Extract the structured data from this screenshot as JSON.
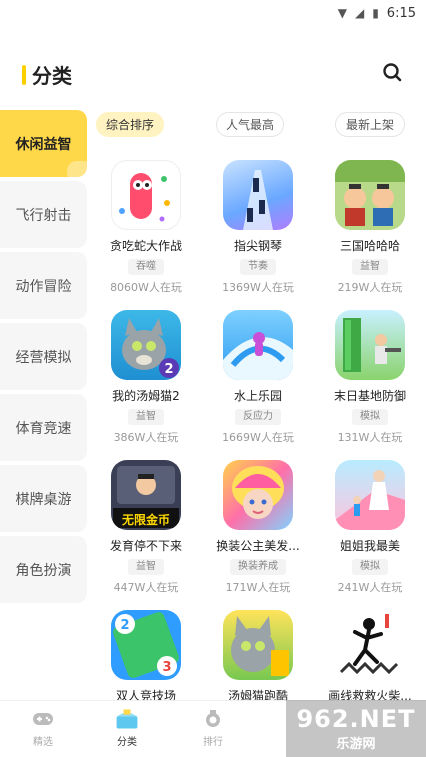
{
  "status_bar": {
    "time": "6:15"
  },
  "header": {
    "title": "分类"
  },
  "sidebar": {
    "items": [
      {
        "label": "休闲益智",
        "active": true
      },
      {
        "label": "飞行射击",
        "active": false
      },
      {
        "label": "动作冒险",
        "active": false
      },
      {
        "label": "经营模拟",
        "active": false
      },
      {
        "label": "体育竞速",
        "active": false
      },
      {
        "label": "棋牌桌游",
        "active": false
      },
      {
        "label": "角色扮演",
        "active": false
      }
    ]
  },
  "sort_tabs": [
    {
      "label": "综合排序",
      "active": true
    },
    {
      "label": "人气最高",
      "active": false
    },
    {
      "label": "最新上架",
      "active": false
    }
  ],
  "games": [
    {
      "name": "贪吃蛇大作战",
      "tag": "吞噬",
      "players": "8060W人在玩",
      "color": "#ff4d6d"
    },
    {
      "name": "指尖钢琴",
      "tag": "节奏",
      "players": "1369W人在玩",
      "color": "#5aa0ff"
    },
    {
      "name": "三国哈哈哈",
      "tag": "益智",
      "players": "219W人在玩",
      "color": "#9cc25a"
    },
    {
      "name": "我的汤姆猫2",
      "tag": "益智",
      "players": "386W人在玩",
      "color": "#3db8e8"
    },
    {
      "name": "水上乐园",
      "tag": "反应力",
      "players": "1669W人在玩",
      "color": "#4fb3ff"
    },
    {
      "name": "末日基地防御",
      "tag": "模拟",
      "players": "131W人在玩",
      "color": "#8ad36d"
    },
    {
      "name": "发育停不下来",
      "tag": "益智",
      "players": "447W人在玩",
      "color": "#5a5f78",
      "badge": "无限金币"
    },
    {
      "name": "换装公主美发...",
      "tag": "换装养成",
      "players": "171W人在玩",
      "color": "#f3a6c8"
    },
    {
      "name": "姐姐我最美",
      "tag": "模拟",
      "players": "241W人在玩",
      "color": "#ff8fb5"
    },
    {
      "name": "双人竞技场",
      "tag": "",
      "players": "",
      "color": "#2f9cff"
    },
    {
      "name": "汤姆猫跑酷",
      "tag": "",
      "players": "",
      "color": "#78c850"
    },
    {
      "name": "画线救救火柴...",
      "tag": "",
      "players": "",
      "color": "#f5f5f5"
    }
  ],
  "tabbar": {
    "items": [
      {
        "label": "精选",
        "active": false
      },
      {
        "label": "分类",
        "active": true
      },
      {
        "label": "排行",
        "active": false
      }
    ]
  },
  "watermark": {
    "line1": "962.NET",
    "line2": "乐游网"
  }
}
